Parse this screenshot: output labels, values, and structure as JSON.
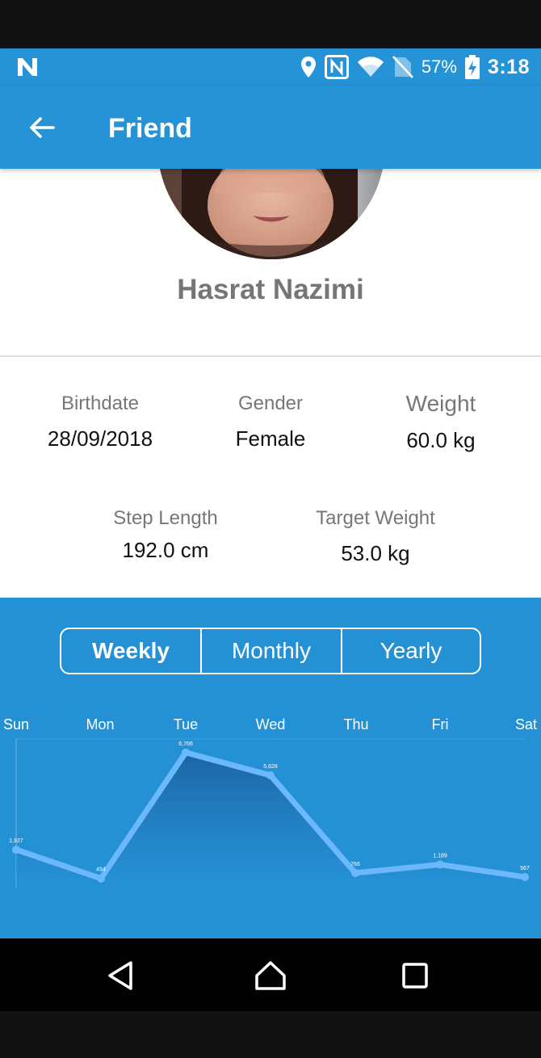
{
  "status_bar": {
    "battery_percent": "57%",
    "time": "3:18",
    "icons": [
      "n-logo-icon",
      "location-icon",
      "nfc-icon",
      "wifi-icon",
      "no-sim-icon",
      "battery-charging-icon"
    ]
  },
  "app_bar": {
    "title": "Friend",
    "back_icon": "arrow-left-icon"
  },
  "profile": {
    "name": "Hasrat Nazimi"
  },
  "details": {
    "birthdate": {
      "label": "Birthdate",
      "value": "28/09/2018"
    },
    "gender": {
      "label": "Gender",
      "value": "Female"
    },
    "weight": {
      "label": "Weight",
      "value": "60.0 kg"
    },
    "step_length": {
      "label": "Step Length",
      "value": "192.0 cm"
    },
    "target_weight": {
      "label": "Target Weight",
      "value": "53.0 kg"
    }
  },
  "period_tabs": {
    "options": [
      "Weekly",
      "Monthly",
      "Yearly"
    ],
    "selected": "Weekly"
  },
  "colors": {
    "primary": "#2693d6",
    "chart_bg": "#2591d5",
    "line": "#6cb8ff",
    "area_top": "#1b5f9e"
  },
  "chart_data": {
    "type": "area",
    "categories": [
      "Sun",
      "Mon",
      "Tue",
      "Wed",
      "Thu",
      "Fri",
      "Sat"
    ],
    "values": [
      1927,
      494,
      6766,
      5628,
      766,
      1189,
      567
    ],
    "value_labels": [
      "1,927",
      "494",
      "6,766",
      "5,628",
      "766",
      "1,189",
      "567"
    ],
    "title": "",
    "xlabel": "",
    "ylabel": "",
    "grid": false,
    "legend": "none"
  },
  "nav_bar": {
    "icons": [
      "back-triangle-icon",
      "home-icon",
      "recents-square-icon"
    ]
  }
}
